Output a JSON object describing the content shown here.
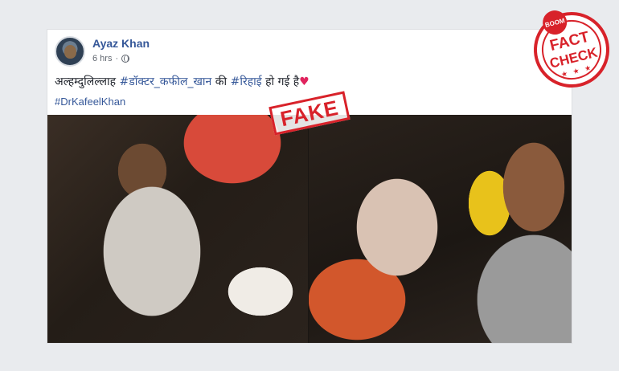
{
  "post": {
    "author": "Ayaz Khan",
    "time": "6 hrs",
    "separator": "·",
    "text_prefix": "अल्हम्दुलिल्लाह ",
    "hashtag1": "#डॉक्टर_कफील_खान",
    "text_mid": " की ",
    "hashtag2": "#रिहाई",
    "text_suffix": " हो गई है",
    "heart": "♥",
    "hashtag3": "#DrKafeelKhan"
  },
  "overlay": {
    "fake_label": "FAKE"
  },
  "badge": {
    "brand": "BOOM",
    "line1": "FACT",
    "line2": "CHECK",
    "stars": "★ ★ ★"
  },
  "colors": {
    "link": "#365899",
    "stamp_red": "#d8222a"
  },
  "icons": {
    "privacy": "globe-icon",
    "reaction": "heart-icon"
  }
}
